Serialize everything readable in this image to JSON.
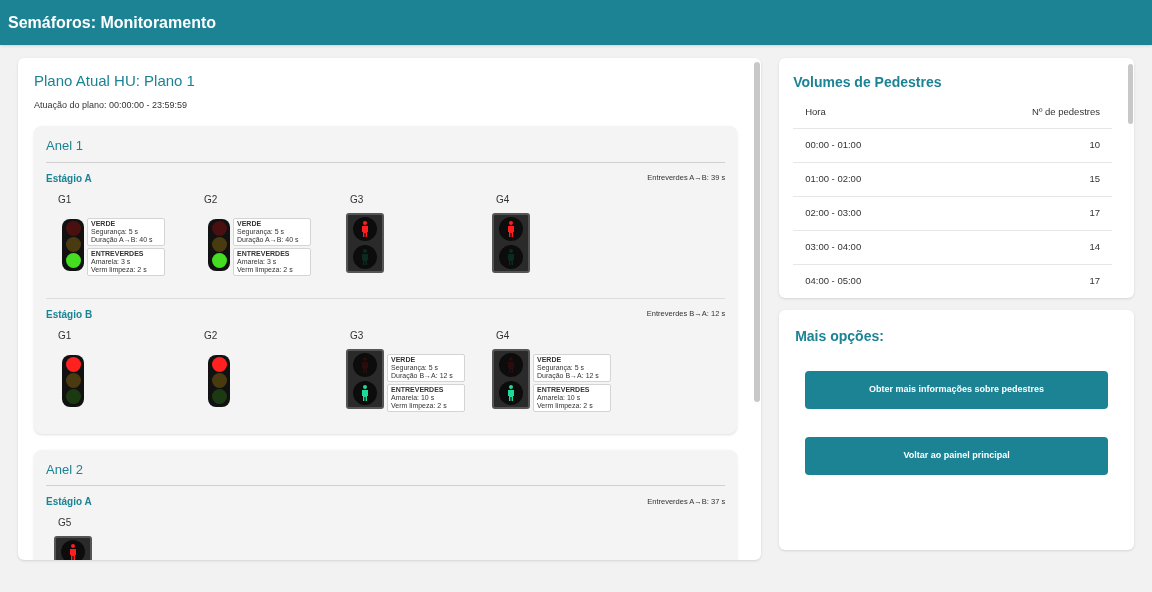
{
  "header": {
    "title": "Semáforos: Monitoramento"
  },
  "plan": {
    "title": "Plano Atual HU: Plano 1",
    "period": "Atuação do plano: 00:00:00 - 23:59:59",
    "rings": [
      {
        "title": "Anel 1",
        "stages": [
          {
            "title": "Estágio A",
            "intergreen": "Entreverdes A→B: 39 s",
            "signals": [
              {
                "label": "G1",
                "kind": "vehicle",
                "red_lit": false,
                "yellow_lit": false,
                "green_lit": true,
                "go_phase": {
                  "title": "VERDE",
                  "lines": [
                    "Segurança: 5 s",
                    "Duração A→B: 40 s"
                  ]
                },
                "clearance": {
                  "title": "ENTREVERDES",
                  "lines": [
                    "Amarela: 3 s",
                    "Verm limpeza: 2 s"
                  ]
                }
              },
              {
                "label": "G2",
                "kind": "vehicle",
                "red_lit": false,
                "yellow_lit": false,
                "green_lit": true,
                "go_phase": {
                  "title": "VERDE",
                  "lines": [
                    "Segurança: 5 s",
                    "Duração A→B: 40 s"
                  ]
                },
                "clearance": {
                  "title": "ENTREVERDES",
                  "lines": [
                    "Amarela: 3 s",
                    "Verm limpeza: 2 s"
                  ]
                }
              },
              {
                "label": "G3",
                "kind": "pedestrian",
                "stop_lit": true,
                "walk_lit": false
              },
              {
                "label": "G4",
                "kind": "pedestrian",
                "stop_lit": true,
                "walk_lit": false
              }
            ]
          },
          {
            "title": "Estágio B",
            "intergreen": "Entreverdes B→A: 12 s",
            "signals": [
              {
                "label": "G1",
                "kind": "vehicle",
                "red_lit": true,
                "yellow_lit": false,
                "green_lit": false
              },
              {
                "label": "G2",
                "kind": "vehicle",
                "red_lit": true,
                "yellow_lit": false,
                "green_lit": false
              },
              {
                "label": "G3",
                "kind": "pedestrian",
                "stop_lit": false,
                "walk_lit": true,
                "go_phase": {
                  "title": "VERDE",
                  "lines": [
                    "Segurança: 5 s",
                    "Duração B→A: 12 s"
                  ]
                },
                "clearance": {
                  "title": "ENTREVERDES",
                  "lines": [
                    "Amarela: 10 s",
                    "Verm limpeza: 2 s"
                  ]
                }
              },
              {
                "label": "G4",
                "kind": "pedestrian",
                "stop_lit": false,
                "walk_lit": true,
                "go_phase": {
                  "title": "VERDE",
                  "lines": [
                    "Segurança: 5 s",
                    "Duração B→A: 12 s"
                  ]
                },
                "clearance": {
                  "title": "ENTREVERDES",
                  "lines": [
                    "Amarela: 10 s",
                    "Verm limpeza: 2 s"
                  ]
                }
              }
            ]
          }
        ]
      },
      {
        "title": "Anel 2",
        "stages": [
          {
            "title": "Estágio A",
            "intergreen": "Entreverdes A→B: 37 s",
            "signals": [
              {
                "label": "G5",
                "kind": "pedestrian",
                "stop_lit": true
              }
            ]
          }
        ]
      }
    ]
  },
  "volumes": {
    "title": "Volumes de Pedestres",
    "columns": [
      "Hora",
      "Nº de pedestres"
    ],
    "rows": [
      [
        "00:00 - 01:00",
        "10"
      ],
      [
        "01:00 - 02:00",
        "15"
      ],
      [
        "02:00 - 03:00",
        "17"
      ],
      [
        "03:00 - 04:00",
        "14"
      ],
      [
        "04:00 - 05:00",
        "17"
      ]
    ]
  },
  "options": {
    "title": "Mais opções:",
    "buttons": [
      "Obter mais informações sobre pedestres",
      "Voltar ao painel principal"
    ]
  }
}
